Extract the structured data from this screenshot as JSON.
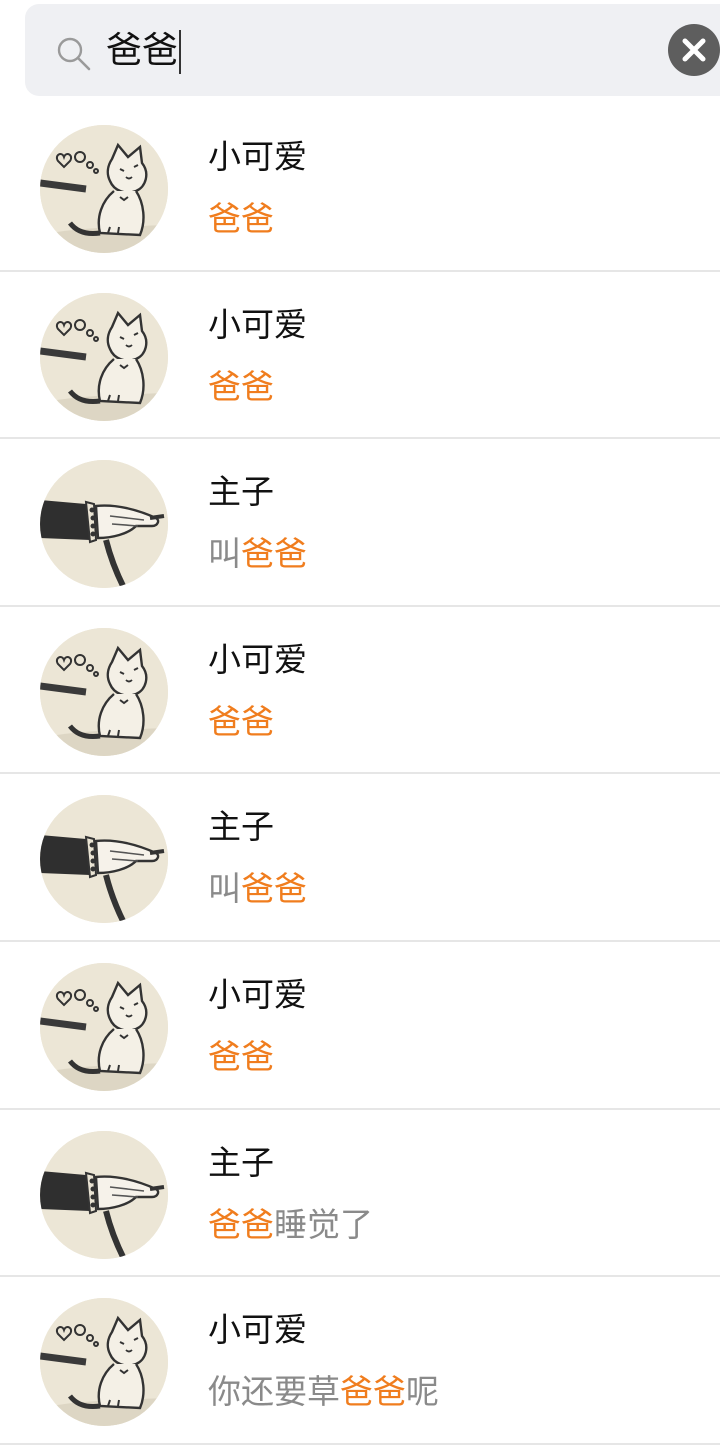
{
  "search": {
    "query": "爸爸",
    "search_icon": "search-icon",
    "clear_icon": "close-icon"
  },
  "colors": {
    "highlight": "#f07d1e",
    "search_bg": "#eff0f3",
    "muted_text": "#8a8a8a",
    "clear_button": "#5e5e5e"
  },
  "results": [
    {
      "avatar": "cat-avatar",
      "name": "小可爱",
      "pre": "",
      "match": "爸爸",
      "post": ""
    },
    {
      "avatar": "cat-avatar",
      "name": "小可爱",
      "pre": "",
      "match": "爸爸",
      "post": ""
    },
    {
      "avatar": "hand-avatar",
      "name": "主子",
      "pre": "叫",
      "match": "爸爸",
      "post": ""
    },
    {
      "avatar": "cat-avatar",
      "name": "小可爱",
      "pre": "",
      "match": "爸爸",
      "post": ""
    },
    {
      "avatar": "hand-avatar",
      "name": "主子",
      "pre": "叫",
      "match": "爸爸",
      "post": ""
    },
    {
      "avatar": "cat-avatar",
      "name": "小可爱",
      "pre": "",
      "match": "爸爸",
      "post": ""
    },
    {
      "avatar": "hand-avatar",
      "name": "主子",
      "pre": "",
      "match": "爸爸",
      "post": "睡觉了"
    },
    {
      "avatar": "cat-avatar",
      "name": "小可爱",
      "pre": "你还要草",
      "match": "爸爸",
      "post": "呢"
    }
  ]
}
